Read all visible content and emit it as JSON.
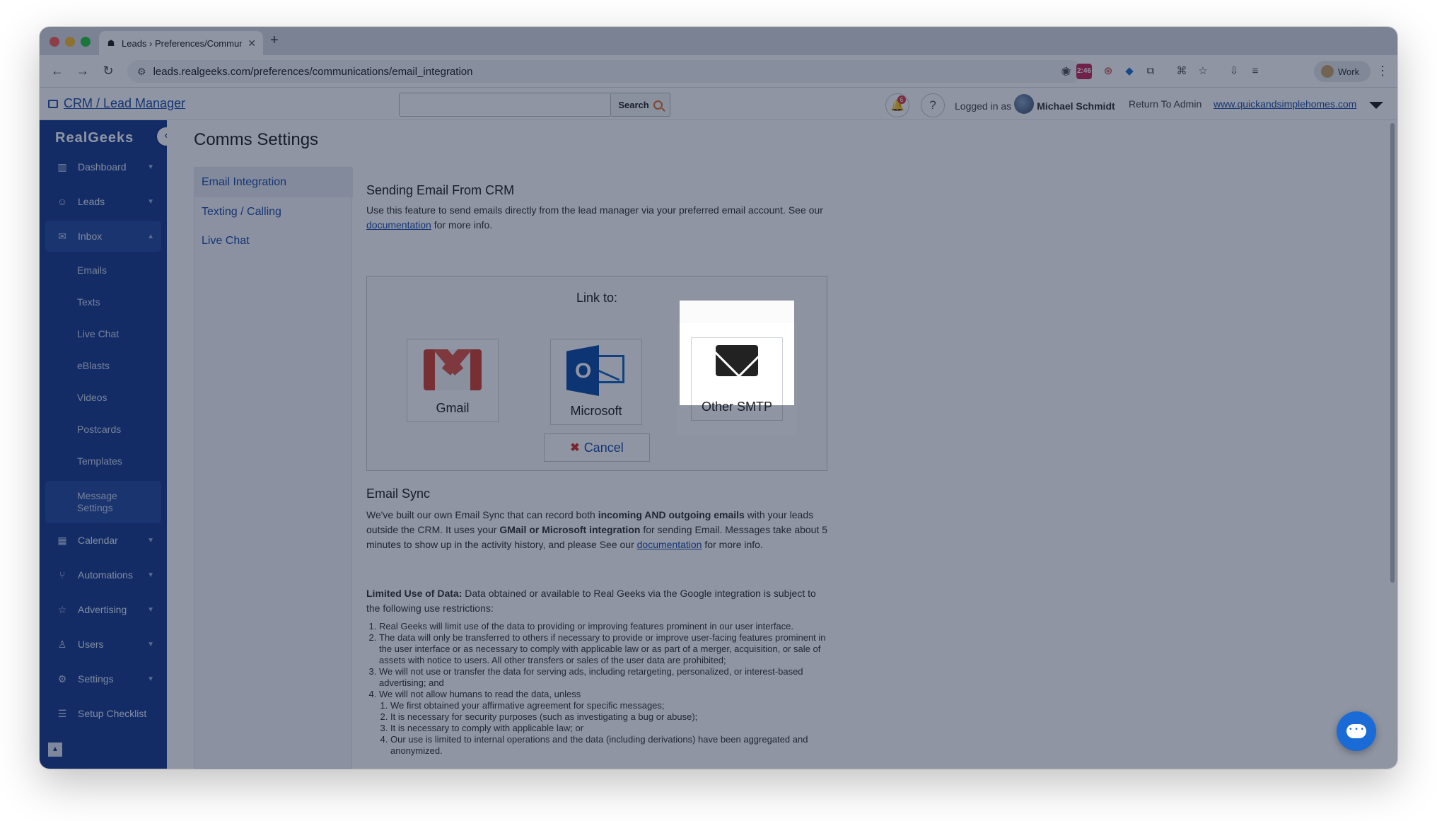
{
  "browser": {
    "tab_title": "Leads › Preferences/Commun",
    "url": "leads.realgeeks.com/preferences/communications/email_integration",
    "ext_badge": "2:46",
    "profile_label": "Work"
  },
  "header": {
    "crm_link": "CRM / Lead Manager",
    "search_placeholder": "",
    "search_label": "Search",
    "notification_count": "6",
    "logged_in_as": "Logged in as",
    "user_name": "Michael Schmidt",
    "return_admin": "Return To Admin",
    "site_link": "www.quickandsimplehomes.com"
  },
  "sidebar": {
    "brand": "RealGeeks",
    "items": [
      {
        "label": "Dashboard",
        "icon": "bar-chart-icon"
      },
      {
        "label": "Leads",
        "icon": "people-icon"
      },
      {
        "label": "Inbox",
        "icon": "envelope-icon"
      },
      {
        "label": "Calendar",
        "icon": "calendar-icon"
      },
      {
        "label": "Automations",
        "icon": "branch-icon"
      },
      {
        "label": "Advertising",
        "icon": "star-icon"
      },
      {
        "label": "Users",
        "icon": "user-icon"
      },
      {
        "label": "Settings",
        "icon": "gear-icon"
      },
      {
        "label": "Setup Checklist",
        "icon": "checklist-icon"
      }
    ],
    "inbox_sub": [
      "Emails",
      "Texts",
      "Live Chat",
      "eBlasts",
      "Videos",
      "Postcards",
      "Templates",
      "Message Settings"
    ]
  },
  "main": {
    "title": "Comms Settings",
    "subnav": [
      "Email Integration",
      "Texting / Calling",
      "Live Chat"
    ],
    "sending": {
      "title": "Sending Email From CRM",
      "text_before": "Use this feature to send emails directly from the lead manager via your preferred email account. See our ",
      "link": "documentation",
      "text_after": " for more info."
    },
    "linkbox": {
      "heading": "Link to:",
      "gmail": "Gmail",
      "microsoft": "Microsoft",
      "smtp": "Other SMTP",
      "cancel": "Cancel"
    },
    "sync": {
      "title": "Email Sync",
      "p1_a": "We've built our own Email Sync that can record both ",
      "p1_b": "incoming AND outgoing emails",
      "p1_c": " with your leads outside the CRM. It uses your ",
      "p1_d": "GMail or Microsoft integration",
      "p1_e": " for sending Email. Messages take about 5 minutes to show up in the activity history, and please See our ",
      "p1_link": "documentation",
      "p1_f": " for more info.",
      "p2_a": "Limited Use of Data:",
      "p2_b": " Data obtained or available to Real Geeks via the Google integration is subject to the following use restrictions:",
      "list": [
        "Real Geeks will limit use of the data to providing or improving features prominent in our user interface.",
        "The data will only be transferred to others if necessary to provide or improve user-facing features prominent in the user interface or as necessary to comply with applicable law or as part of a merger, acquisition, or sale of assets with notice to users. All other transfers or sales of the user data are prohibited;",
        "We will not use or transfer the data for serving ads, including retargeting, personalized, or interest-based advertising; and",
        "We will not allow humans to read the data, unless"
      ],
      "sublist": [
        "We first obtained your affirmative agreement for specific messages;",
        "It is necessary for security purposes (such as investigating a bug or abuse);",
        "It is necessary to comply with applicable law; or",
        "Our use is limited to internal operations and the data (including derivations) have been aggregated and anonymized."
      ]
    }
  },
  "colors": {
    "sidebar": "#1b3d8f",
    "link": "#1f4fa8",
    "accent": "#e0712c"
  }
}
